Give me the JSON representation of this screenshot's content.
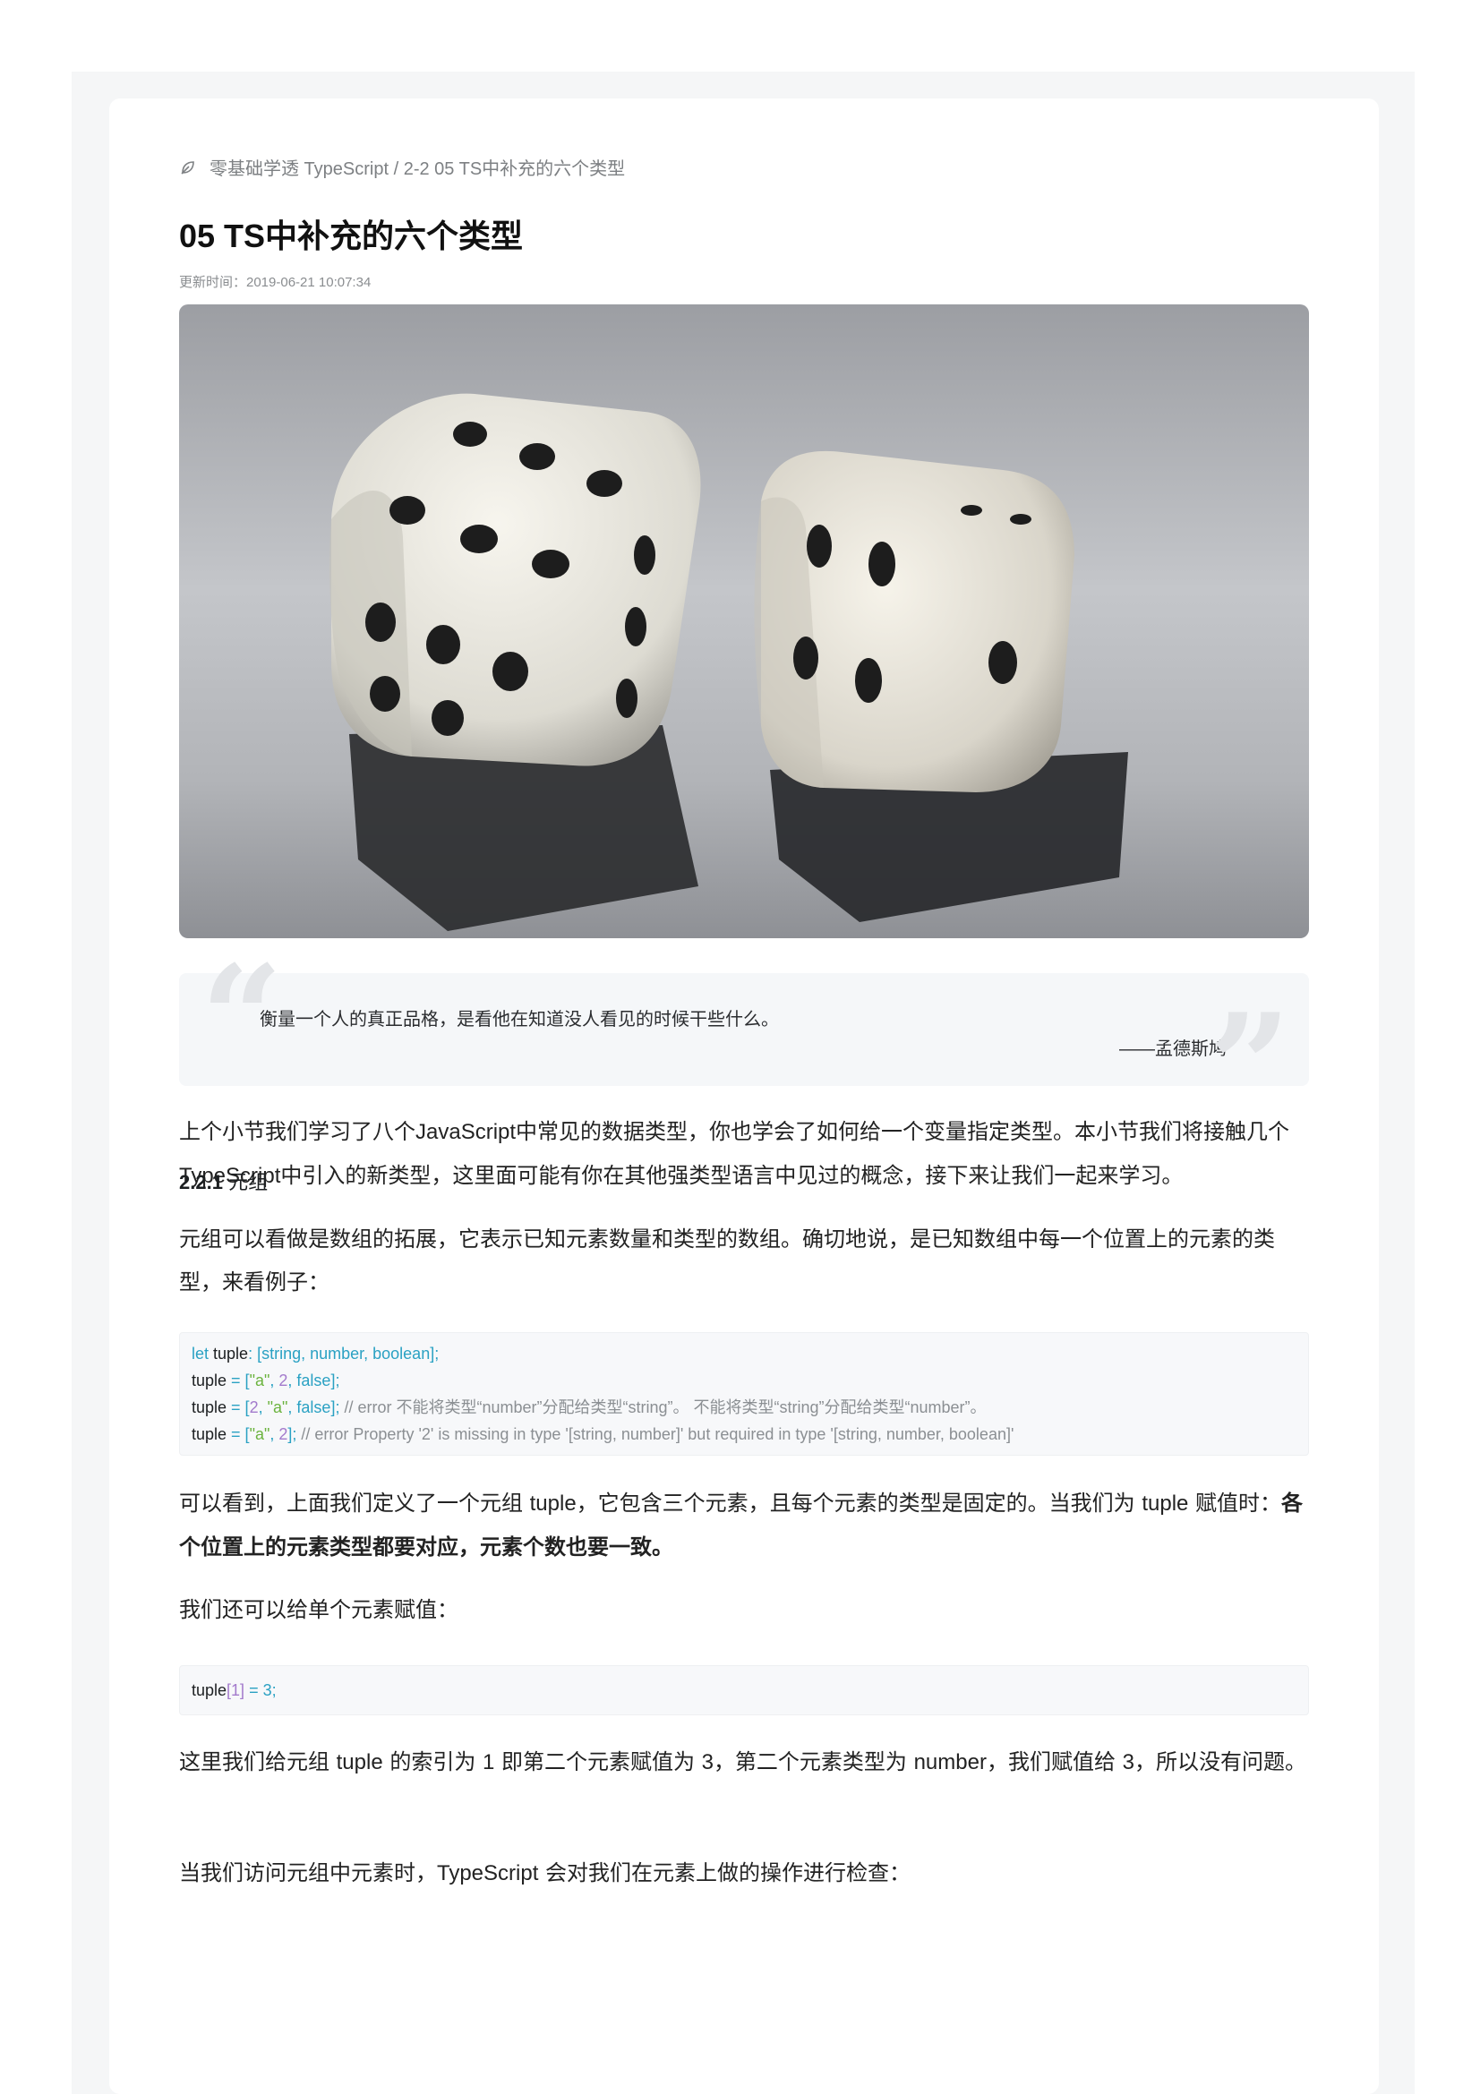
{
  "breadcrumb": "零基础学透 TypeScript / 2-2 05 TS中补充的六个类型",
  "title": "05 TS中补充的六个类型",
  "updated": "更新时间：2019-06-21 10:07:34",
  "hero_image": {
    "subject": "two-white-dice-icon"
  },
  "quote": {
    "text": "衡量一个人的真正品格，是看他在知道没人看见的时候干些什么。",
    "author": "——孟德斯鸠"
  },
  "intro": {
    "part1": "上个小节我们学习了八个",
    "js": "JavaScript",
    "part2": "中常见的数据类型，你也学会了如何给一个变量指定类型。本小节我们将接触几个",
    "ts": "TypeScript",
    "part3": "中引入的新类型，这里面可能有你在其他强类型语言中见过的概念，接下来让我们一起来学习。"
  },
  "section": {
    "number": "2.2.1",
    "title": "元组"
  },
  "para_tuple_def": "元组可以看做是数组的拓展，它表示已知元素数量和类型的数组。确切地说，是已知数组中每一个位置上的元素的类型，来看例子：",
  "code1": {
    "l1": {
      "kw": "let",
      "name": " tuple",
      "colon": ": ",
      "type": "[string, number, boolean]",
      "end": ";"
    },
    "l2": {
      "name": "tuple",
      "eq": " = [",
      "s1": "\"a\"",
      "c1": ", ",
      "n1": "2",
      "c2": ", ",
      "b1": "false",
      "end": "];"
    },
    "l3": {
      "name": "tuple",
      "eq": " = [",
      "n1": "2",
      "c1": ", ",
      "s1": "\"a\"",
      "c2": ", ",
      "b1": "false",
      "end": "]; ",
      "comment": "// error 不能将类型“number”分配给类型“string”。 不能将类型“string”分配给类型“number”。"
    },
    "l4": {
      "name": "tuple",
      "eq": " = [",
      "s1": "\"a\"",
      "c1": ", ",
      "n1": "2",
      "end": "]; ",
      "comment": "// error Property '2' is missing in type '[string, number]' but required in type '[string, number, boolean]'"
    }
  },
  "para_after_code1": {
    "p1": "可以看到，上面我们定义了一个元组 ",
    "tuple1": "tuple",
    "p2": "，它包含三个元素，且每个元素的类型是固定的。当我们为 ",
    "tuple2": "tuple",
    "p3": " 赋值时：",
    "bold": "各个位置上的元素类型都要对应，元素个数也要一致。"
  },
  "para_single": "我们还可以给单个元素赋值：",
  "code2": {
    "name": "tuple",
    "idx": "[1]",
    "rest": " = 3;"
  },
  "para_index": {
    "p1": "这里我们给元组 ",
    "tuple": "tuple",
    "p2": " 的索引为 ",
    "one": "1",
    "p3": " 即第二个元素赋值为 ",
    "three1": "3",
    "p4": "，第二个元素类型为 ",
    "number": "number",
    "p5": "，我们赋值给 ",
    "three2": "3",
    "p6": "，所以没有问题。"
  },
  "para_access": {
    "p1": "当我们访问元组中元素时，",
    "ts": "TypeScript",
    "p2": " 会对我们在元素上做的操作进行检查："
  }
}
